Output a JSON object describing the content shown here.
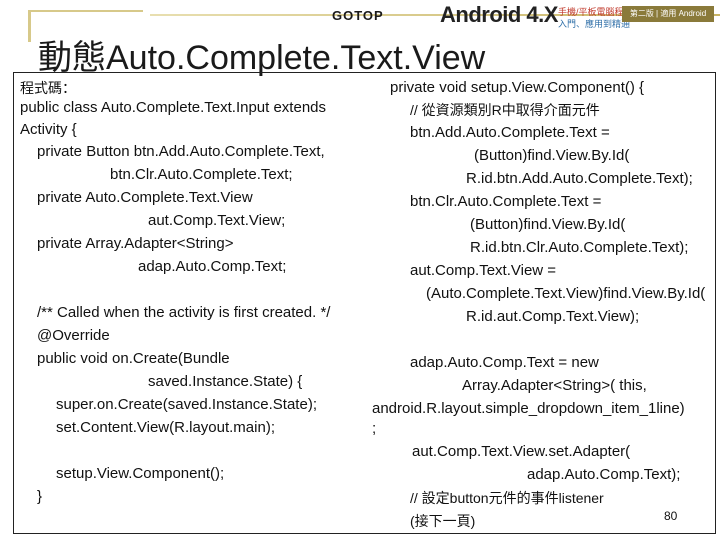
{
  "header": {
    "publisher_logo": "GOTOP",
    "book_logo": "Android 4.X",
    "book_subtitle_1": "手機/平板電腦程式設計",
    "book_subtitle_2": "入門、應用到精通",
    "series_badge": "第二版 | 適用 Android 1.x~4.x"
  },
  "slide": {
    "title": "動態Auto.Complete.Text.View",
    "page_number": "80"
  },
  "left_column": [
    "程式碼：",
    "public class Auto.Complete.Text.Input extends",
    "Activity {",
    "private Button btn.Add.Auto.Complete.Text,",
    "btn.Clr.Auto.Complete.Text;",
    "private Auto.Complete.Text.View",
    "aut.Comp.Text.View;",
    "private Array.Adapter<String>",
    "adap.Auto.Comp.Text;",
    "/** Called when the activity is first created. */",
    "@Override",
    "public void on.Create(Bundle",
    "saved.Instance.State) {",
    "super.on.Create(saved.Instance.State);",
    "set.Content.View(R.layout.main);",
    "setup.View.Component();",
    "}"
  ],
  "right_column": [
    "private void setup.View.Component() {",
    "// 從資源類別R中取得介面元件",
    "btn.Add.Auto.Complete.Text =",
    "(Button)find.View.By.Id(",
    "R.id.btn.Add.Auto.Complete.Text);",
    "btn.Clr.Auto.Complete.Text =",
    "(Button)find.View.By.Id(",
    "R.id.btn.Clr.Auto.Complete.Text);",
    "aut.Comp.Text.View =",
    "(Auto.Complete.Text.View)find.View.By.Id(",
    "R.id.aut.Comp.Text.View);",
    "adap.Auto.Comp.Text = new",
    "Array.Adapter<String>( this,",
    "android.R.layout.simple_dropdown_item_1line)",
    ";",
    "aut.Comp.Text.View.set.Adapter(",
    "adap.Auto.Comp.Text);",
    "// 設定button元件的事件listener",
    "(接下一頁)"
  ]
}
